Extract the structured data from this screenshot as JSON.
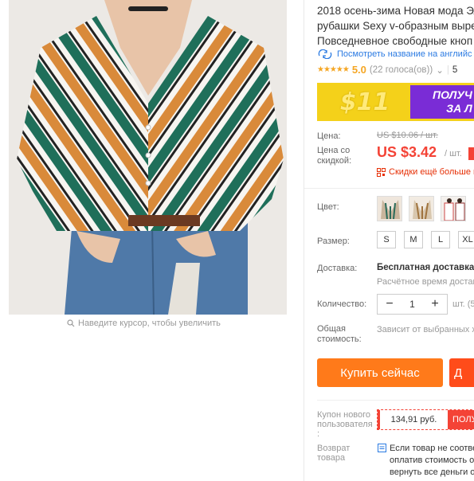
{
  "gallery": {
    "zoom_hint": "Наведите курсор, чтобы увеличить"
  },
  "product": {
    "title_line1": "2018 осень-зима Новая мода Эл",
    "title_line2": "рубашки Sexy v-образным выре",
    "title_line3": "Повседневное свободные кноп",
    "translate_link": "Посмотреть название на английс",
    "rating_score": "5.0",
    "rating_votes": "(22 голоса(ов))",
    "orders_partial": "5"
  },
  "banner": {
    "amount": "$11",
    "text_line1": "ПОЛУЧ",
    "text_line2": "ЗА Л"
  },
  "price": {
    "label": "Цена:",
    "old": "US $10.06 / шт.",
    "discount_label": "Цена со скидкой:",
    "current": "US $3.42",
    "unit": "/ шт.",
    "extra_discount_link": "Скидки ещё больше г"
  },
  "options": {
    "color_label": "Цвет:",
    "size_label": "Размер:",
    "sizes": [
      "S",
      "M",
      "L",
      "XL"
    ]
  },
  "shipping": {
    "label": "Доставка:",
    "title": "Бесплатная доставка в",
    "subtitle": "Расчётное время достав"
  },
  "quantity": {
    "label": "Количество:",
    "value": "1",
    "minus": "−",
    "plus": "+",
    "unit": "шт. (5"
  },
  "total": {
    "label": "Общая стоимость:",
    "value": "Зависит от выбранных х"
  },
  "actions": {
    "buy_now": "Купить сейчас",
    "add_to_cart": "Д"
  },
  "coupon": {
    "label": "Купон нового пользователя :",
    "amount": "134,91 руб.",
    "get": "ПОЛУ"
  },
  "returns": {
    "label": "Возврат товара",
    "line1": "Если товар не соотве",
    "line2": "оплатив стоимость о",
    "line3": "вернуть все деньги о комп"
  },
  "colors": {
    "accent": "#ff7a1a",
    "price": "#f44336",
    "link": "#2a7ae2",
    "star": "#f5a623"
  }
}
